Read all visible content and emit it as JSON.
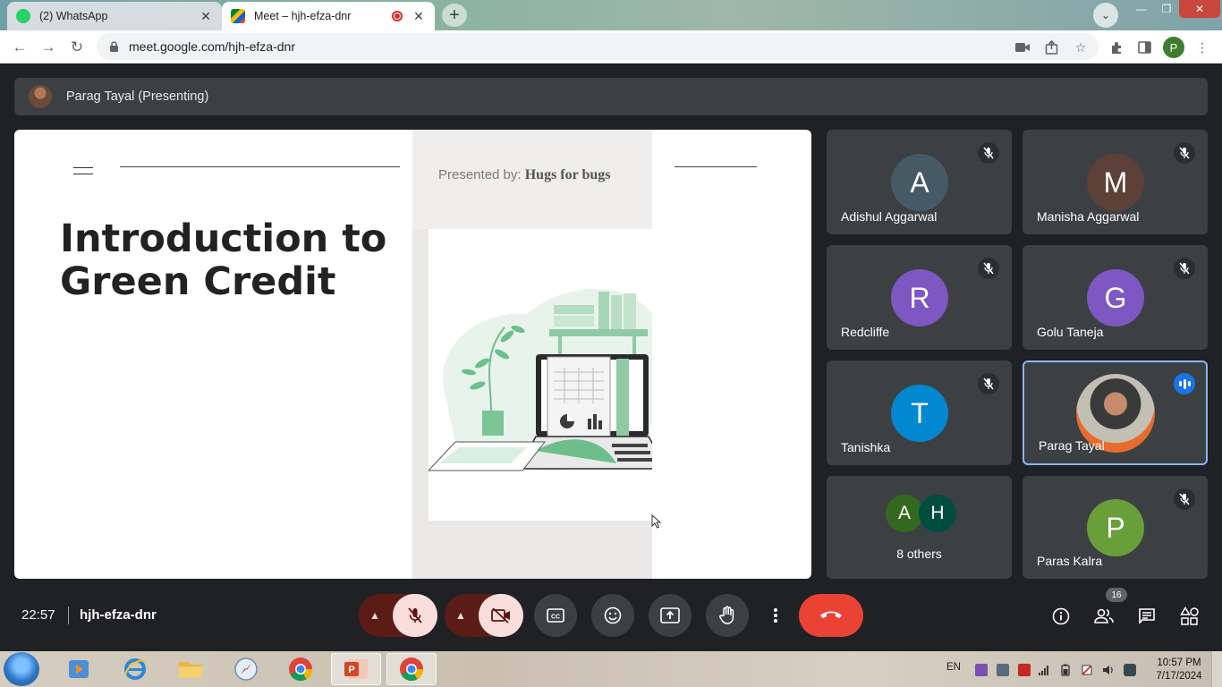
{
  "browser": {
    "tabs": [
      {
        "title": "(2) WhatsApp",
        "active": false
      },
      {
        "title": "Meet – hjh-efza-dnr",
        "active": true
      }
    ],
    "url": "meet.google.com/hjh-efza-dnr",
    "profile_initial": "P"
  },
  "meet": {
    "presenter_label": "Parag Tayal (Presenting)",
    "slide": {
      "presented_by_prefix": "Presented by:",
      "presented_by_name": "Hugs for bugs",
      "title": "Introduction to Green Credit"
    },
    "participants": [
      {
        "initial": "A",
        "name": "Adishul Aggarwal",
        "color": "#455a64",
        "muted": true
      },
      {
        "initial": "M",
        "name": "Manisha Aggarwal",
        "color": "#5d4037",
        "muted": true
      },
      {
        "initial": "R",
        "name": "Redcliffe",
        "color": "#7e57c2",
        "muted": true
      },
      {
        "initial": "G",
        "name": "Golu Taneja",
        "color": "#7e57c2",
        "muted": true
      },
      {
        "initial": "T",
        "name": "Tanishka",
        "color": "#0288d1",
        "muted": true
      },
      {
        "initial": "",
        "name": "Parag Tayal",
        "color": "#8d6e63",
        "muted": false,
        "speaking": true
      },
      {
        "initial": "P",
        "name": "Paras Kalra",
        "color": "#689f38",
        "muted": true
      }
    ],
    "others": {
      "initials": [
        "A",
        "H"
      ],
      "colors": [
        "#33691e",
        "#004d40"
      ],
      "label": "8 others"
    },
    "time": "22:57",
    "meeting_code": "hjh-efza-dnr",
    "participant_count": "16"
  },
  "taskbar": {
    "language": "EN",
    "time": "10:57 PM",
    "date": "7/17/2024"
  }
}
